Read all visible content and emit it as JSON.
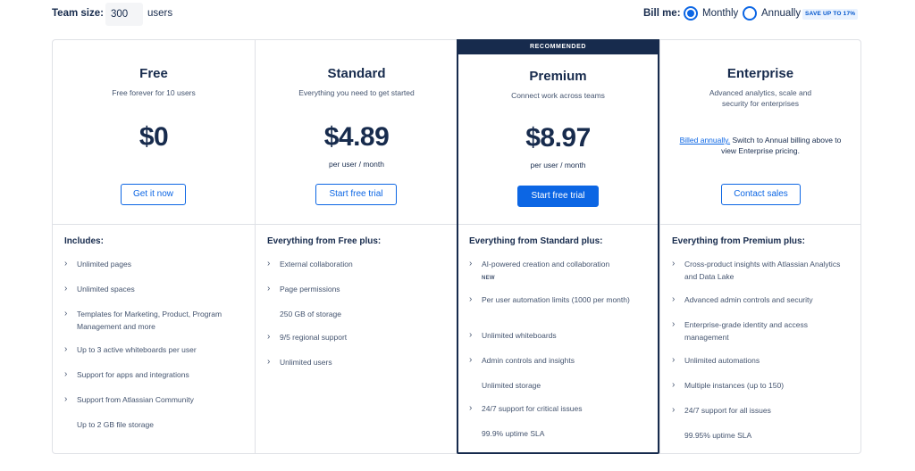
{
  "team": {
    "label": "Team size:",
    "value": "300",
    "unit": "users"
  },
  "billing": {
    "label": "Bill me:",
    "options": [
      {
        "label": "Monthly",
        "selected": true
      },
      {
        "label": "Annually",
        "selected": false
      }
    ],
    "save_badge": "SAVE UP TO 17%"
  },
  "colors": {
    "accent": "#0c66e4",
    "text": "#172b4d",
    "border": "#dfe1e6",
    "banner": "#172b4d"
  },
  "plans": [
    {
      "name": "Free",
      "tagline": "Free forever for 10 users",
      "price": "$0",
      "per": "",
      "button": "Get it now",
      "includes_title": "Includes:",
      "features": [
        "Unlimited pages",
        "Unlimited spaces",
        "Templates for Marketing, Product, Program Management and more",
        "Up to 3 active whiteboards per user",
        "Support for apps and integrations",
        "Support from Atlassian Community",
        "Up to 2 GB file storage"
      ]
    },
    {
      "name": "Standard",
      "tagline": "Everything you need to get started",
      "price": "$4.89",
      "per": "per user / month",
      "button": "Start free trial",
      "includes_title": "Everything from Free plus:",
      "features": [
        "External collaboration",
        "Page permissions",
        "250 GB of storage",
        "9/5 regional support",
        "Unlimited users"
      ]
    },
    {
      "name": "Premium",
      "recommended": "RECOMMENDED",
      "tagline": "Connect work across teams",
      "price": "$8.97",
      "per": "per user / month",
      "button": "Start free trial",
      "includes_title": "Everything from Standard plus:",
      "features": [
        "AI-powered creation and collaboration",
        "Per user automation limits (1000 per month)",
        "Unlimited whiteboards",
        "Admin controls and insights",
        "Unlimited storage",
        "24/7 support for critical issues",
        "99.9% uptime SLA"
      ],
      "new_badge": "NEW"
    },
    {
      "name": "Enterprise",
      "tagline": "Advanced analytics, scale and security for enterprises",
      "note_link": "Billed annually.",
      "note_text": " Switch to Annual billing above to view Enterprise pricing.",
      "button": "Contact sales",
      "includes_title": "Everything from Premium plus:",
      "features": [
        "Cross-product insights with Atlassian Analytics and Data Lake",
        "Advanced admin controls and security",
        "Enterprise-grade identity and access management",
        "Unlimited automations",
        "Multiple instances (up to 150)",
        "24/7 support for all issues",
        "99.95% uptime SLA"
      ]
    }
  ]
}
